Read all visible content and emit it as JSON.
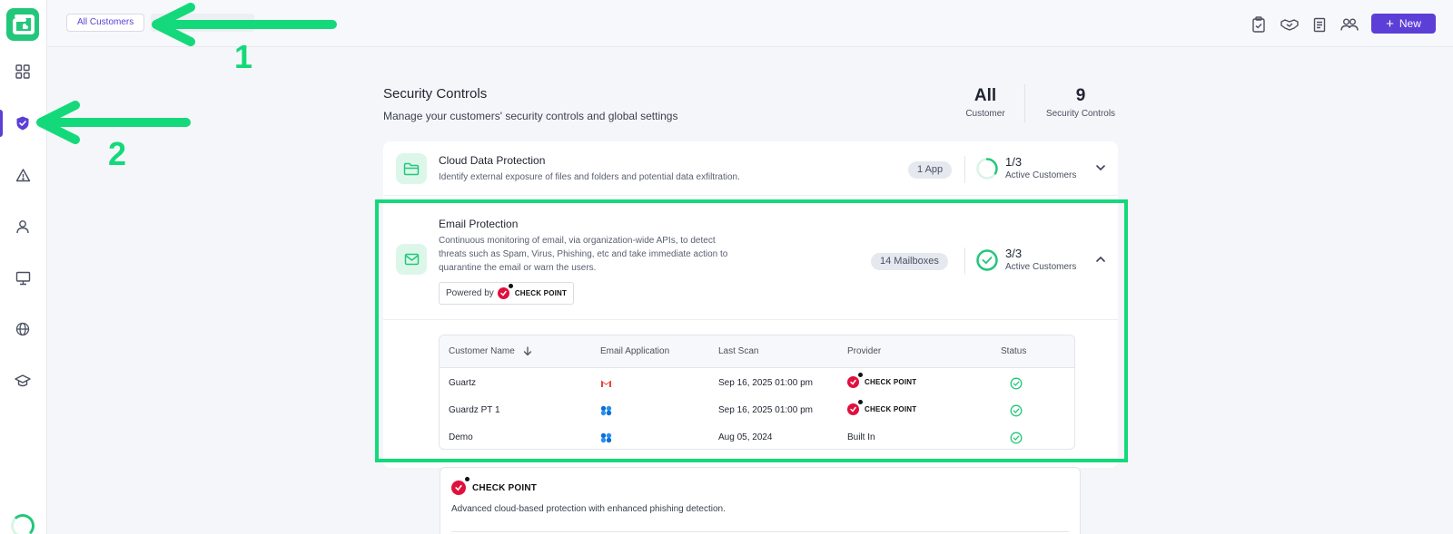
{
  "breadcrumb": {
    "label": "All Customers"
  },
  "header": {
    "new_label": "New"
  },
  "page": {
    "title": "Security Controls",
    "subtitle": "Manage your customers' security controls and global settings"
  },
  "stats": [
    {
      "value": "All",
      "label": "Customer"
    },
    {
      "value": "9",
      "label": "Security Controls"
    }
  ],
  "controls": {
    "cloud": {
      "title": "Cloud Data Protection",
      "description": "Identify external exposure of files and folders and potential data exfiltration.",
      "badge": "1 App",
      "fraction": "1/3",
      "active_label": "Active Customers",
      "progress": 0.333
    },
    "email": {
      "title": "Email Protection",
      "description_lines": [
        "Continuous monitoring of email, via organization-wide APIs, to detect",
        "threats such as Spam, Virus, Phishing, etc and take immediate action to",
        "quarantine the email or warn the users."
      ],
      "powered_by": "Powered by",
      "badge": "14 Mailboxes",
      "fraction": "3/3",
      "active_label": "Active Customers",
      "progress": 1
    }
  },
  "brand": {
    "checkpoint_text": "CHECK POINT"
  },
  "table": {
    "headers": [
      "Customer Name",
      "Email Application",
      "Last Scan",
      "Provider",
      "Status"
    ],
    "rows": [
      {
        "customer": "Guartz",
        "app": "gmail-icon",
        "last_scan": "Sep 16, 2025 01:00 pm",
        "provider": "CHECK POINT",
        "status": "ok"
      },
      {
        "customer": "Guardz PT 1",
        "app": "outlook-icon",
        "last_scan": "Sep 16, 2025 01:00 pm",
        "provider": "CHECK POINT",
        "status": "ok"
      },
      {
        "customer": "Demo",
        "app": "outlook-icon",
        "last_scan": "Aug 05, 2024",
        "provider": "Built In",
        "status": "ok"
      }
    ]
  },
  "checkpoint_card": {
    "brand": "CHECK POINT",
    "description": "Advanced cloud-based protection with enhanced phishing detection."
  },
  "annotations": {
    "one": "1",
    "two": "2"
  },
  "colors": {
    "accent": "#5b3fd6",
    "brand_green": "#22c77a",
    "annotation_green": "#14d97a",
    "checkpoint_red": "#e0103c"
  }
}
